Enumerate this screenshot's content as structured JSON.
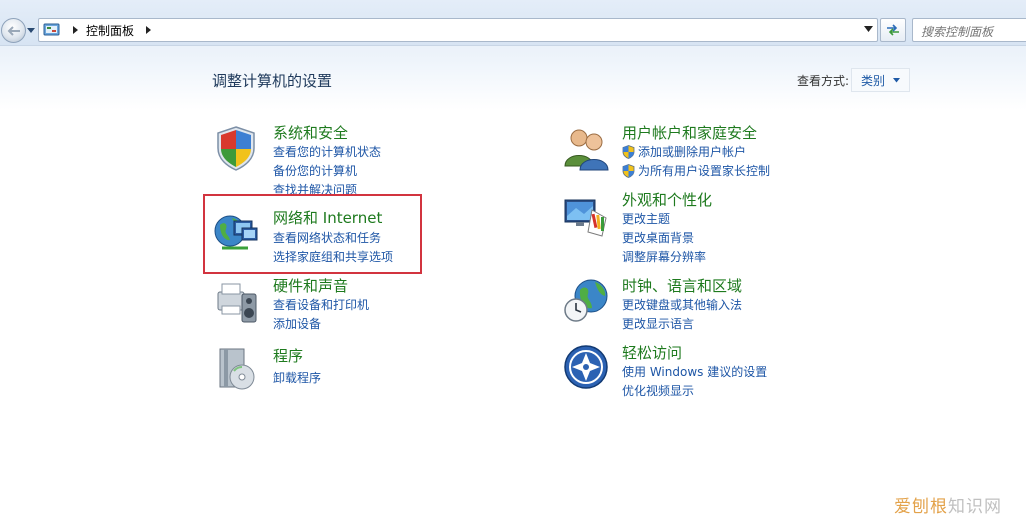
{
  "address": {
    "breadcrumb": "控制面板",
    "search_placeholder": "搜索控制面板"
  },
  "header": {
    "title": "调整计算机的设置",
    "view_label": "查看方式:",
    "view_value": "类别"
  },
  "categories": [
    {
      "title": "系统和安全",
      "links": [
        "查看您的计算机状态",
        "备份您的计算机",
        "查找并解决问题"
      ]
    },
    {
      "title": "网络和 Internet",
      "links": [
        "查看网络状态和任务",
        "选择家庭组和共享选项"
      ]
    },
    {
      "title": "硬件和声音",
      "links": [
        "查看设备和打印机",
        "添加设备"
      ]
    },
    {
      "title": "程序",
      "links": [
        "卸载程序"
      ]
    },
    {
      "title": "用户帐户和家庭安全",
      "links": [
        "添加或删除用户帐户",
        "为所有用户设置家长控制"
      ]
    },
    {
      "title": "外观和个性化",
      "links": [
        "更改主题",
        "更改桌面背景",
        "调整屏幕分辨率"
      ]
    },
    {
      "title": "时钟、语言和区域",
      "links": [
        "更改键盘或其他输入法",
        "更改显示语言"
      ]
    },
    {
      "title": "轻松访问",
      "links": [
        "使用 Windows 建议的设置",
        "优化视频显示"
      ]
    }
  ],
  "watermark": {
    "brand": "爱刨根",
    "suffix": "知识网"
  },
  "colors": {
    "category_title": "#1e7a1e",
    "link": "#1e56a6",
    "highlight_border": "#d2343f"
  }
}
